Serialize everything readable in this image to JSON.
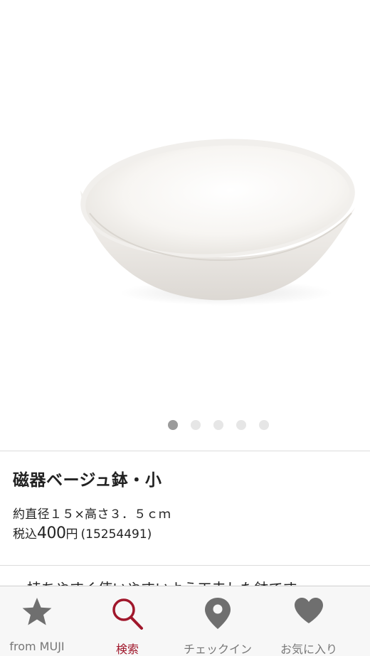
{
  "gallery": {
    "image_alt": "磁器ベージュ鉢・小",
    "page_count": 5,
    "current_page": 1
  },
  "product": {
    "title": "磁器ベージュ鉢・小",
    "size": "約直径１５×高さ３．５ｃｍ",
    "price_prefix": "税込",
    "price_value": "400",
    "price_unit": "円",
    "code": "(15254491)",
    "description": "・持ちやすく使いやすいよう工夫した鉢です。"
  },
  "tabbar": {
    "items": [
      {
        "label": "from MUJI",
        "icon": "star-icon",
        "active": false
      },
      {
        "label": "検索",
        "icon": "search-icon",
        "active": true
      },
      {
        "label": "チェックイン",
        "icon": "map-pin-icon",
        "active": false
      },
      {
        "label": "お気に入り",
        "icon": "heart-icon",
        "active": false
      }
    ]
  },
  "colors": {
    "accent": "#a0172b",
    "tab_inactive": "#777777",
    "icon_inactive": "#6f6f6f",
    "dot_active": "#9b9b9b",
    "dot_inactive": "#e6e6e6"
  }
}
